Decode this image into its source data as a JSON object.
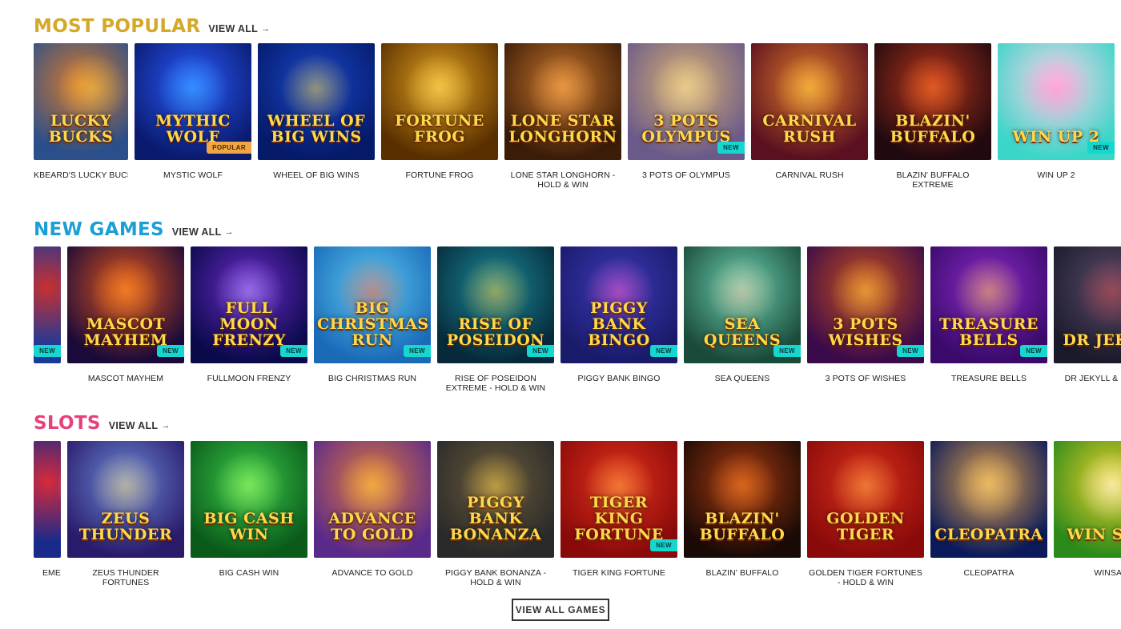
{
  "colors": {
    "most_popular": "#d4a82a",
    "new_games": "#1b9fd6",
    "slots": "#e8407c",
    "new_badge": "#16d6d0",
    "popular_badge": "#f0a642"
  },
  "sections": [
    {
      "id": "most-popular",
      "title": "MOST POPULAR",
      "view_all": "VIEW ALL",
      "games": [
        {
          "name": "KBEARD'S LUCKY BUCKS",
          "logo": "LUCKY BUCKS",
          "badge": "",
          "bg": [
            "#2a4f8a",
            "#d97a2b"
          ],
          "glow": "#ffcf4a"
        },
        {
          "name": "MYSTIC WOLF",
          "logo": "MYTHIC WOLF",
          "badge": "POPULAR",
          "bg": [
            "#0a1a6e",
            "#2a5bff"
          ],
          "glow": "#3fb8ff"
        },
        {
          "name": "WHEEL OF BIG WINS",
          "logo": "WHEEL OF BIG WINS",
          "badge": "",
          "bg": [
            "#061a6a",
            "#1747c9"
          ],
          "glow": "#f5d142"
        },
        {
          "name": "FORTUNE FROG",
          "logo": "FORTUNE FROG",
          "badge": "",
          "bg": [
            "#5a2f00",
            "#e0a020"
          ],
          "glow": "#ffe066"
        },
        {
          "name": "LONE STAR LONGHORN - HOLD & WIN",
          "logo": "LONE STAR LONGHORN",
          "badge": "",
          "bg": [
            "#3a1c08",
            "#c8742a"
          ],
          "glow": "#ffb35a"
        },
        {
          "name": "3 POTS OF OLYMPUS",
          "logo": "3 POTS OLYMPUS",
          "badge": "NEW",
          "bg": [
            "#6a5a8a",
            "#d8b070"
          ],
          "glow": "#f7e0a0"
        },
        {
          "name": "CARNIVAL RUSH",
          "logo": "CARNIVAL RUSH",
          "badge": "",
          "bg": [
            "#5a1020",
            "#e07a2a"
          ],
          "glow": "#ffd24a"
        },
        {
          "name": "BLAZIN' BUFFALO EXTREME",
          "logo": "BLAZIN' BUFFALO",
          "badge": "",
          "bg": [
            "#200a10",
            "#b8341a"
          ],
          "glow": "#ff7a2a"
        },
        {
          "name": "WIN UP 2",
          "logo": "WIN UP 2",
          "badge": "NEW",
          "bg": [
            "#3ad6c8",
            "#ffd0ea"
          ],
          "glow": "#ff80c8"
        }
      ]
    },
    {
      "id": "new-games",
      "title": "NEW GAMES",
      "view_all": "VIEW ALL",
      "games": [
        {
          "name": "",
          "logo": "",
          "badge": "NEW",
          "bg": [
            "#1a3a9a",
            "#c83030"
          ],
          "glow": "#5a8aff"
        },
        {
          "name": "MASCOT MAYHEM",
          "logo": "MASCOT MAYHEM",
          "badge": "NEW",
          "bg": [
            "#1a0a3a",
            "#e0541a"
          ],
          "glow": "#ff9a2a"
        },
        {
          "name": "FULLMOON FRENZY",
          "logo": "FULL MOON FRENZY",
          "badge": "NEW",
          "bg": [
            "#0a0a4a",
            "#6a2ac8"
          ],
          "glow": "#b8a0ff"
        },
        {
          "name": "BIG CHRISTMAS RUN",
          "logo": "BIG CHRISTMAS RUN",
          "badge": "NEW",
          "bg": [
            "#1a6ab8",
            "#5ac8f0"
          ],
          "glow": "#ff5a3a"
        },
        {
          "name": "RISE OF POSEIDON EXTREME - HOLD & WIN",
          "logo": "RISE OF POSEIDON",
          "badge": "NEW",
          "bg": [
            "#062a3a",
            "#1a8a9a"
          ],
          "glow": "#f0c040"
        },
        {
          "name": "PIGGY BANK BINGO",
          "logo": "PIGGY BANK BINGO",
          "badge": "NEW",
          "bg": [
            "#1a1a6a",
            "#3a3ab8"
          ],
          "glow": "#ff5ac8"
        },
        {
          "name": "SEA QUEENS",
          "logo": "SEA QUEENS",
          "badge": "NEW",
          "bg": [
            "#1a4a3a",
            "#6ad0b0"
          ],
          "glow": "#f0c0a0"
        },
        {
          "name": "3 POTS OF WISHES",
          "logo": "3 POTS WISHES",
          "badge": "NEW",
          "bg": [
            "#3a0a4a",
            "#c8501a"
          ],
          "glow": "#ffd04a"
        },
        {
          "name": "TREASURE BELLS",
          "logo": "TREASURE BELLS",
          "badge": "NEW",
          "bg": [
            "#3a0a6a",
            "#8a2ac8"
          ],
          "glow": "#ffc84a"
        },
        {
          "name": "DR JEKYLL & MR HYDE",
          "logo": "DR JEKYLL",
          "badge": "",
          "bg": [
            "#1a1a2a",
            "#5a4a6a"
          ],
          "glow": "#c84a4a"
        }
      ]
    },
    {
      "id": "slots",
      "title": "SLOTS",
      "view_all": "VIEW ALL",
      "games": [
        {
          "name": "EME",
          "logo": "",
          "badge": "",
          "bg": [
            "#1a2a8a",
            "#d82a3a"
          ],
          "glow": "#ffffff"
        },
        {
          "name": "ZEUS THUNDER FORTUNES",
          "logo": "ZEUS THUNDER",
          "badge": "",
          "bg": [
            "#2a1a6a",
            "#6a8ad8"
          ],
          "glow": "#f0d07a"
        },
        {
          "name": "BIG CASH WIN",
          "logo": "BIG CASH WIN",
          "badge": "",
          "bg": [
            "#0a5a1a",
            "#3ac84a"
          ],
          "glow": "#b0ff6a"
        },
        {
          "name": "ADVANCE TO GOLD",
          "logo": "ADVANCE TO GOLD",
          "badge": "",
          "bg": [
            "#5a2a8a",
            "#e0783a"
          ],
          "glow": "#ffd04a"
        },
        {
          "name": "PIGGY BANK BONANZA - HOLD & WIN",
          "logo": "PIGGY BANK BONANZA",
          "badge": "",
          "bg": [
            "#2a2a2a",
            "#6a5a3a"
          ],
          "glow": "#ffd04a"
        },
        {
          "name": "TIGER KING FORTUNE",
          "logo": "TIGER KING FORTUNE",
          "badge": "NEW",
          "bg": [
            "#8a0a0a",
            "#e0301a"
          ],
          "glow": "#ffb04a"
        },
        {
          "name": "BLAZIN' BUFFALO",
          "logo": "BLAZIN' BUFFALO",
          "badge": "",
          "bg": [
            "#1a0a06",
            "#a83a10"
          ],
          "glow": "#ff8a2a"
        },
        {
          "name": "GOLDEN TIGER FORTUNES - HOLD & WIN",
          "logo": "GOLDEN TIGER",
          "badge": "",
          "bg": [
            "#8a0a0a",
            "#d8301a"
          ],
          "glow": "#ffb04a"
        },
        {
          "name": "CLEOPATRA",
          "logo": "CLEOPATRA",
          "badge": "",
          "bg": [
            "#0a1a5a",
            "#e0a04a"
          ],
          "glow": "#f0d07a"
        },
        {
          "name": "WINSANI",
          "logo": "WIN SANI",
          "badge": "",
          "bg": [
            "#2a8a1a",
            "#f0d02a"
          ],
          "glow": "#ffffff"
        }
      ]
    }
  ],
  "footer": {
    "view_all_games": "VIEW ALL GAMES"
  }
}
